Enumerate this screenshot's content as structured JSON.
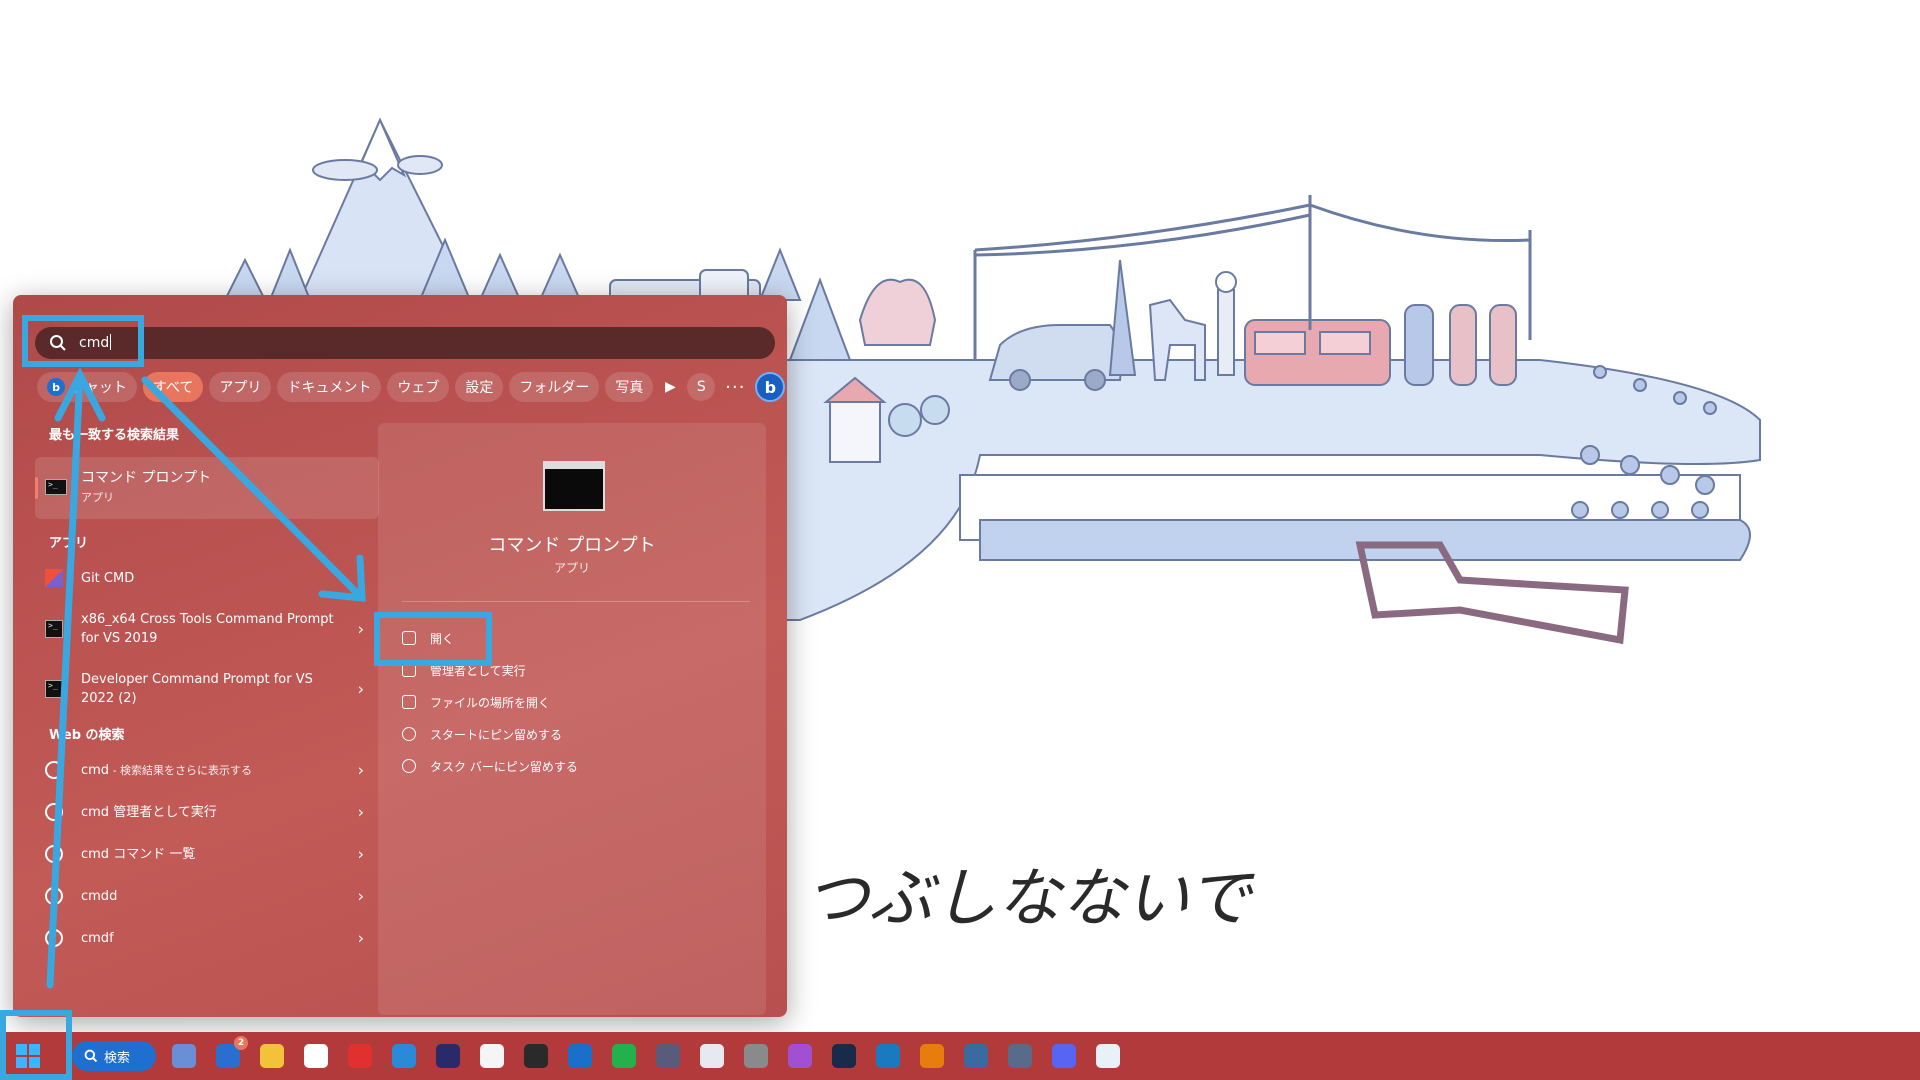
{
  "search": {
    "value": "cmd"
  },
  "filters": {
    "chat": "チャット",
    "items": [
      "すべて",
      "アプリ",
      "ドキュメント",
      "ウェブ",
      "設定",
      "フォルダー",
      "写真"
    ],
    "s_label": "S",
    "more": "···"
  },
  "best_match": {
    "heading": "最も一致する検索結果",
    "title": "コマンド プロンプト",
    "subtitle": "アプリ"
  },
  "apps": {
    "heading": "アプリ",
    "items": [
      {
        "label": "Git CMD"
      },
      {
        "label": "x86_x64 Cross Tools Command Prompt for VS 2019"
      },
      {
        "label": "Developer Command Prompt for VS 2022 (2)"
      }
    ]
  },
  "web": {
    "heading": "Web の検索",
    "items": [
      {
        "label": "cmd",
        "suffix": " - 検索結果をさらに表示する"
      },
      {
        "label": "cmd 管理者として実行",
        "suffix": ""
      },
      {
        "label": "cmd コマンド 一覧",
        "suffix": ""
      },
      {
        "label": "cmdd",
        "suffix": ""
      },
      {
        "label": "cmdf",
        "suffix": ""
      }
    ]
  },
  "detail": {
    "title": "コマンド プロンプト",
    "subtitle": "アプリ",
    "actions": [
      "開く",
      "管理者として実行",
      "ファイルの場所を開く",
      "スタートにピン留めする",
      "タスク バーにピン留めする"
    ]
  },
  "taskbar": {
    "search_label": "検索",
    "badge_count": "2",
    "apps": [
      {
        "icon": "copilot-icon",
        "color": "#6a8fd8"
      },
      {
        "icon": "mail-icon",
        "color": "#2a6fcf"
      },
      {
        "icon": "folder-icon",
        "color": "#f3c13a"
      },
      {
        "icon": "media-icon",
        "color": "#ffffff"
      },
      {
        "icon": "vivaldi-icon",
        "color": "#e03030"
      },
      {
        "icon": "vscode-icon",
        "color": "#2a8ad8"
      },
      {
        "icon": "jetbrains-icon",
        "color": "#2a2a6a"
      },
      {
        "icon": "notepad-icon",
        "color": "#f5f5f5"
      },
      {
        "icon": "terminal-icon",
        "color": "#2a2a2a"
      },
      {
        "icon": "outlook-icon",
        "color": "#1a6fc8"
      },
      {
        "icon": "line-icon",
        "color": "#22b14c"
      },
      {
        "icon": "calculator-icon",
        "color": "#5a5a7a"
      },
      {
        "icon": "snipping-icon",
        "color": "#e8e8f0"
      },
      {
        "icon": "usb-icon",
        "color": "#8a8a8a"
      },
      {
        "icon": "drop-icon",
        "color": "#a050d0"
      },
      {
        "icon": "steam-icon",
        "color": "#1a2a4a"
      },
      {
        "icon": "caption-icon",
        "color": "#1a7abf"
      },
      {
        "icon": "blender-icon",
        "color": "#e87d0d"
      },
      {
        "icon": "remote-icon",
        "color": "#3a6aa0"
      },
      {
        "icon": "camera-icon",
        "color": "#5a6a8a"
      },
      {
        "icon": "discord-icon",
        "color": "#5865f2"
      },
      {
        "icon": "app-icon",
        "color": "#e8f0f8"
      }
    ]
  },
  "wallpaper": {
    "handwritten_text": "つぶしなないで"
  }
}
